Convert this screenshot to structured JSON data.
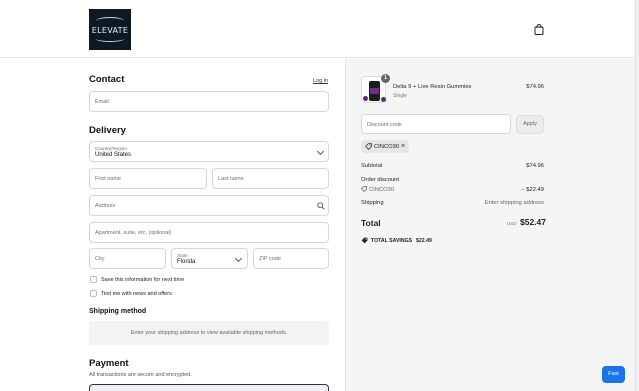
{
  "header": {
    "logo_text": "ELEVATE",
    "cart_icon": "shopping-bag-icon"
  },
  "contact": {
    "heading": "Contact",
    "login_link": "Log in",
    "email_placeholder": "Email"
  },
  "delivery": {
    "heading": "Delivery",
    "country_label": "Country/Region",
    "country_value": "United States",
    "first_name_placeholder": "First name",
    "last_name_placeholder": "Last name",
    "address_placeholder": "Address",
    "apartment_placeholder": "Apartment, suite, etc. (optional)",
    "city_placeholder": "City",
    "state_label": "State",
    "state_value": "Florida",
    "zip_placeholder": "ZIP code",
    "save_info_label": "Save this information for next time",
    "text_me_label": "Text me with news and offers"
  },
  "shipping_method": {
    "heading": "Shipping method",
    "message": "Enter your shipping address to view available shipping methods."
  },
  "payment": {
    "heading": "Payment",
    "subtitle": "All transactions are secure and encrypted."
  },
  "summary": {
    "product_name": "Delta 9 + Live Resin Gummies",
    "product_variant": "Single",
    "product_price": "$74.96",
    "quantity": "1",
    "discount_placeholder": "Discount code",
    "apply_label": "Apply",
    "applied_code": "CINCO30",
    "subtotal_label": "Subtotal",
    "subtotal_value": "$74.96",
    "order_discount_label": "Order discount",
    "discount_code": "CINCO30",
    "discount_value": "− $22.49",
    "shipping_label": "Shipping",
    "shipping_value": "Enter shipping address",
    "total_label": "Total",
    "currency": "USD",
    "total_value": "$52.47",
    "savings_label": "TOTAL SAVINGS",
    "savings_value": "$22.49"
  },
  "fast_button": "Fast",
  "colors": {
    "accent": "#1a73e8",
    "logo_bg": "#0d1a24",
    "summary_bg": "#f5f5f5"
  }
}
